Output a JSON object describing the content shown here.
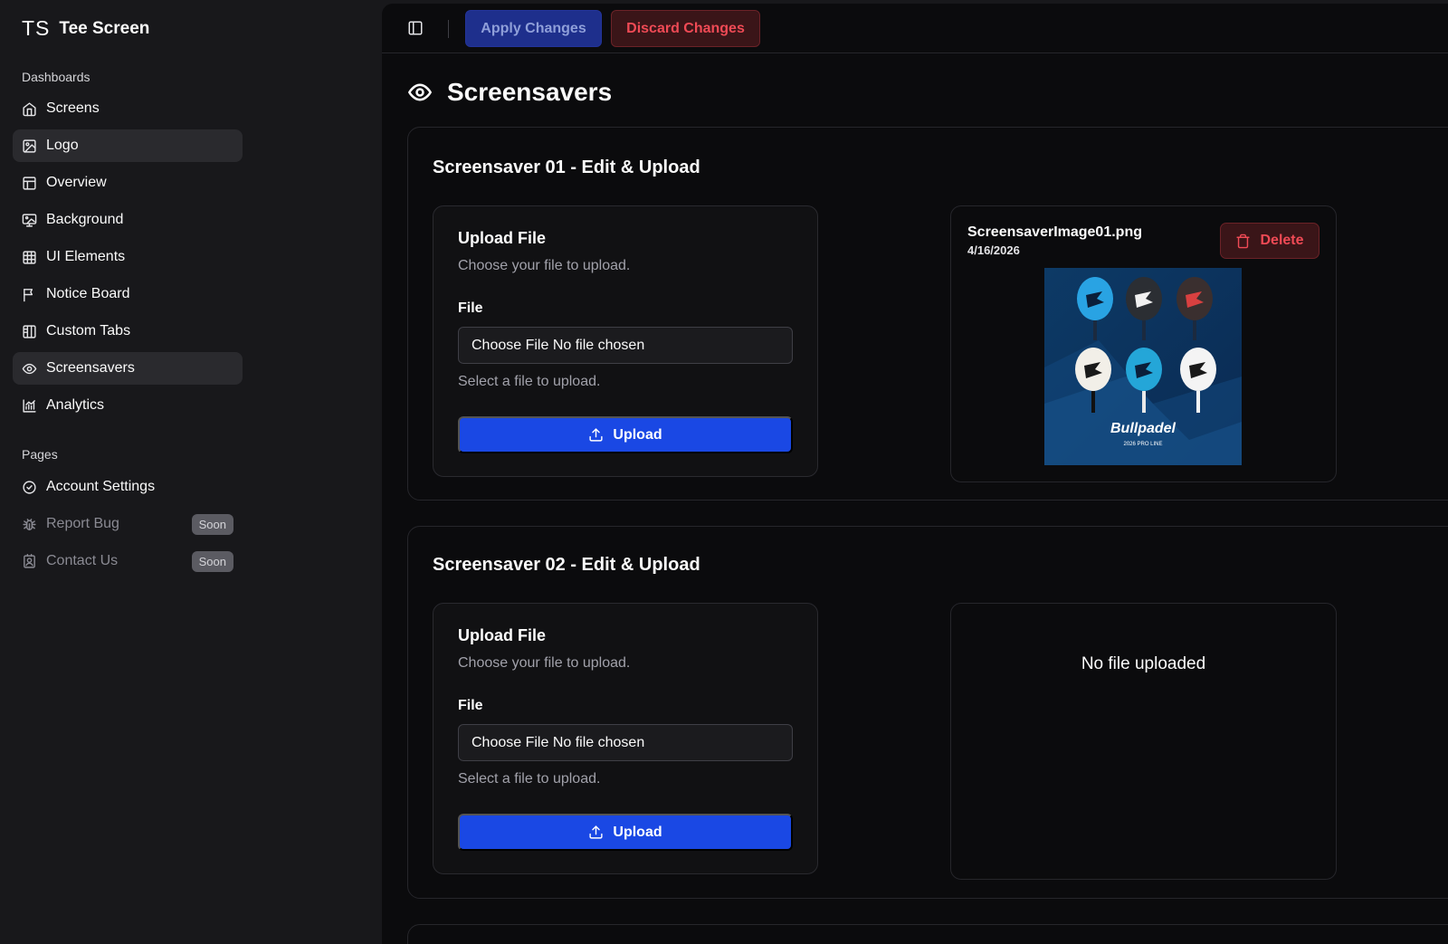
{
  "brand": {
    "logo": "TS",
    "name": "Tee Screen"
  },
  "sidebar": {
    "dashboards_label": "Dashboards",
    "dashboards": [
      {
        "label": "Screens",
        "icon": "home-icon"
      },
      {
        "label": "Logo",
        "icon": "image-icon"
      },
      {
        "label": "Overview",
        "icon": "layout-icon"
      },
      {
        "label": "Background",
        "icon": "monitor-image-icon"
      },
      {
        "label": "UI Elements",
        "icon": "grid-icon"
      },
      {
        "label": "Notice Board",
        "icon": "flag-icon"
      },
      {
        "label": "Custom Tabs",
        "icon": "columns-icon"
      },
      {
        "label": "Screensavers",
        "icon": "eye-icon"
      },
      {
        "label": "Analytics",
        "icon": "chart-icon"
      }
    ],
    "pages_label": "Pages",
    "pages": [
      {
        "label": "Account Settings",
        "icon": "check-circle-icon"
      },
      {
        "label": "Report Bug",
        "icon": "bug-icon",
        "badge": "Soon"
      },
      {
        "label": "Contact Us",
        "icon": "contact-icon",
        "badge": "Soon"
      }
    ]
  },
  "toolbar": {
    "apply_label": "Apply Changes",
    "discard_label": "Discard Changes"
  },
  "page": {
    "title": "Screensavers"
  },
  "screensavers": [
    {
      "title": "Screensaver 01 - Edit & Upload",
      "upload": {
        "title": "Upload File",
        "subtitle": "Choose your file to upload.",
        "field_label": "File",
        "input_value": "Choose File No file chosen",
        "help": "Select a file to upload.",
        "button_label": "Upload"
      },
      "preview": {
        "file_name": "ScreensaverImage01.png",
        "date": "4/16/2026",
        "delete_label": "Delete",
        "image_brand": "Bullpadel",
        "image_caption": "2026 PRO LINE"
      }
    },
    {
      "title": "Screensaver 02 - Edit & Upload",
      "upload": {
        "title": "Upload File",
        "subtitle": "Choose your file to upload.",
        "field_label": "File",
        "input_value": "Choose File No file chosen",
        "help": "Select a file to upload.",
        "button_label": "Upload"
      },
      "preview": {
        "empty_message": "No file uploaded"
      }
    }
  ],
  "colors": {
    "accent": "#1a48e4",
    "danger": "#ef4a55",
    "background": "#0b0b0d",
    "sidebar": "#18181b"
  }
}
